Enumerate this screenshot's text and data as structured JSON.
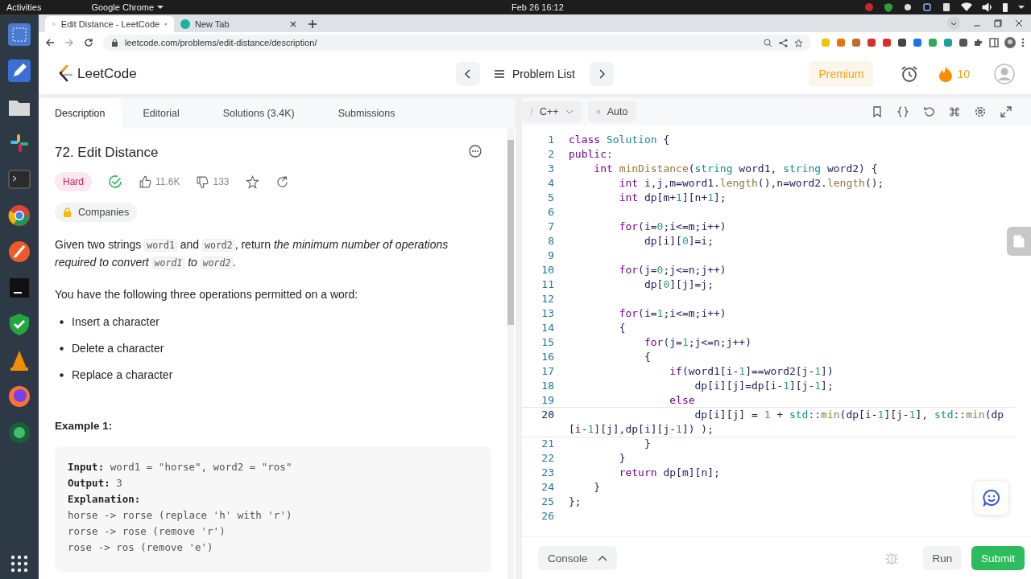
{
  "system_bar": {
    "activities": "Activities",
    "app_menu": "Google Chrome",
    "clock": "Feb 26  16:12"
  },
  "browser": {
    "tabs": [
      {
        "title": "Edit Distance - LeetCode",
        "selected": true
      },
      {
        "title": "New Tab",
        "selected": false
      }
    ],
    "url": "leetcode.com/problems/edit-distance/description/"
  },
  "header": {
    "logo": "LeetCode",
    "problem_list": "Problem List",
    "premium": "Premium",
    "streak": "10"
  },
  "tabs": [
    {
      "label": "Description",
      "selected": true
    },
    {
      "label": "Editorial",
      "selected": false
    },
    {
      "label": "Solutions (3.4K)",
      "selected": false
    },
    {
      "label": "Submissions",
      "selected": false
    }
  ],
  "problem": {
    "title": "72. Edit Distance",
    "difficulty": "Hard",
    "solved": true,
    "likes": "11.6K",
    "dislikes": "133",
    "companies": "Companies",
    "statement": [
      {
        "text": "Given two strings ",
        "kind": "text"
      },
      {
        "text": "word1",
        "kind": "code"
      },
      {
        "text": " and ",
        "kind": "text"
      },
      {
        "text": "word2",
        "kind": "code"
      },
      {
        "text": ", return ",
        "kind": "text"
      },
      {
        "text": "the minimum number of operations required to convert ",
        "kind": "em"
      },
      {
        "text": "word1",
        "kind": "em_code"
      },
      {
        "text": " to ",
        "kind": "em"
      },
      {
        "text": "word2",
        "kind": "em_code"
      },
      {
        "text": ".",
        "kind": "text"
      }
    ],
    "intro": "You have the following three operations permitted on a word:",
    "operations": [
      "Insert a character",
      "Delete a character",
      "Replace a character"
    ],
    "example": {
      "title": "Example 1:",
      "lines": [
        {
          "label": "Input:",
          "text": "word1 = \"horse\", word2 = \"ros\""
        },
        {
          "label": "Output:",
          "text": "3"
        },
        {
          "label": "Explanation:"
        },
        {
          "text": "horse -> rorse (replace 'h' with 'r')"
        },
        {
          "text": "rorse -> rose (remove 'r')"
        },
        {
          "text": "rose -> ros (remove 'e')"
        }
      ]
    }
  },
  "editor": {
    "language": "C++",
    "mode": "Auto",
    "lines": [
      {
        "number": "1",
        "active": false,
        "tokens": [
          {
            "text": "class ",
            "kind": "kw"
          },
          {
            "text": "Solution",
            "kind": "type"
          },
          {
            "text": " {",
            "kind": "plain"
          }
        ]
      },
      {
        "number": "2",
        "active": false,
        "tokens": [
          {
            "text": "public:",
            "kind": "kw"
          }
        ]
      },
      {
        "number": "3",
        "active": false,
        "tokens": [
          {
            "text": "    int ",
            "kind": "kw"
          },
          {
            "text": "minDistance",
            "kind": "fn"
          },
          {
            "text": "(",
            "kind": "plain"
          },
          {
            "text": "string",
            "kind": "type"
          },
          {
            "text": " word1, ",
            "kind": "plain"
          },
          {
            "text": "string",
            "kind": "type"
          },
          {
            "text": " word2) {",
            "kind": "plain"
          }
        ]
      },
      {
        "number": "4",
        "active": false,
        "tokens": [
          {
            "text": "        int",
            "kind": "kw"
          },
          {
            "text": " i,j,m=word1.",
            "kind": "plain"
          },
          {
            "text": "length",
            "kind": "fn"
          },
          {
            "text": "(),n=word2.",
            "kind": "plain"
          },
          {
            "text": "length",
            "kind": "fn"
          },
          {
            "text": "();",
            "kind": "plain"
          }
        ]
      },
      {
        "number": "5",
        "active": false,
        "tokens": [
          {
            "text": "        int",
            "kind": "kw"
          },
          {
            "text": " dp[m+",
            "kind": "plain"
          },
          {
            "text": "1",
            "kind": "num"
          },
          {
            "text": "][n+",
            "kind": "plain"
          },
          {
            "text": "1",
            "kind": "num"
          },
          {
            "text": "];",
            "kind": "plain"
          }
        ]
      },
      {
        "number": "6",
        "active": false
      },
      {
        "number": "7",
        "active": false,
        "tokens": [
          {
            "text": "        for",
            "kind": "kw"
          },
          {
            "text": "(i=",
            "kind": "plain"
          },
          {
            "text": "0",
            "kind": "num"
          },
          {
            "text": ";i<=m;i++)",
            "kind": "plain"
          }
        ]
      },
      {
        "number": "8",
        "active": false,
        "tokens": [
          {
            "text": "            dp[i][",
            "kind": "plain"
          },
          {
            "text": "0",
            "kind": "num"
          },
          {
            "text": "]=i;",
            "kind": "plain"
          }
        ]
      },
      {
        "number": "9",
        "active": false
      },
      {
        "number": "10",
        "active": false,
        "tokens": [
          {
            "text": "        for",
            "kind": "kw"
          },
          {
            "text": "(j=",
            "kind": "plain"
          },
          {
            "text": "0",
            "kind": "num"
          },
          {
            "text": ";j<=n;j++)",
            "kind": "plain"
          }
        ]
      },
      {
        "number": "11",
        "active": false,
        "tokens": [
          {
            "text": "            dp[",
            "kind": "plain"
          },
          {
            "text": "0",
            "kind": "num"
          },
          {
            "text": "][j]=j;",
            "kind": "plain"
          }
        ]
      },
      {
        "number": "12",
        "active": false
      },
      {
        "number": "13",
        "active": false,
        "tokens": [
          {
            "text": "        for",
            "kind": "kw"
          },
          {
            "text": "(i=",
            "kind": "plain"
          },
          {
            "text": "1",
            "kind": "num"
          },
          {
            "text": ";i<=m;i++)",
            "kind": "plain"
          }
        ]
      },
      {
        "number": "14",
        "active": false,
        "tokens": [
          {
            "text": "        {",
            "kind": "plain"
          }
        ]
      },
      {
        "number": "15",
        "active": false,
        "tokens": [
          {
            "text": "            for",
            "kind": "kw"
          },
          {
            "text": "(j=",
            "kind": "plain"
          },
          {
            "text": "1",
            "kind": "num"
          },
          {
            "text": ";j<=n;j++)",
            "kind": "plain"
          }
        ]
      },
      {
        "number": "16",
        "active": false,
        "tokens": [
          {
            "text": "            {",
            "kind": "plain"
          }
        ]
      },
      {
        "number": "17",
        "active": false,
        "tokens": [
          {
            "text": "                if",
            "kind": "kw"
          },
          {
            "text": "(word1[i-",
            "kind": "plain"
          },
          {
            "text": "1",
            "kind": "num"
          },
          {
            "text": "]==word2[j-",
            "kind": "plain"
          },
          {
            "text": "1",
            "kind": "num"
          },
          {
            "text": "])",
            "kind": "plain"
          }
        ]
      },
      {
        "number": "18",
        "active": false,
        "tokens": [
          {
            "text": "                    dp[i][j]=dp[i-",
            "kind": "plain"
          },
          {
            "text": "1",
            "kind": "num"
          },
          {
            "text": "][j-",
            "kind": "plain"
          },
          {
            "text": "1",
            "kind": "num"
          },
          {
            "text": "];",
            "kind": "plain"
          }
        ]
      },
      {
        "number": "19",
        "active": false,
        "tokens": [
          {
            "text": "                else",
            "kind": "kw"
          }
        ]
      },
      {
        "number": "20",
        "active": true,
        "tokens": [
          {
            "text": "                    dp[i][j] = ",
            "kind": "plain"
          },
          {
            "text": "1",
            "kind": "num"
          },
          {
            "text": " + ",
            "kind": "plain"
          },
          {
            "text": "std",
            "kind": "type"
          },
          {
            "text": "::",
            "kind": "plain"
          },
          {
            "text": "min",
            "kind": "fn"
          },
          {
            "text": "(dp[i-",
            "kind": "plain"
          },
          {
            "text": "1",
            "kind": "num"
          },
          {
            "text": "][j-",
            "kind": "plain"
          },
          {
            "text": "1",
            "kind": "num"
          },
          {
            "text": "], ",
            "kind": "plain"
          },
          {
            "text": "std",
            "kind": "type"
          },
          {
            "text": "::",
            "kind": "plain"
          },
          {
            "text": "min",
            "kind": "fn"
          },
          {
            "text": "(dp[i-",
            "kind": "plain"
          },
          {
            "text": "1",
            "kind": "num"
          },
          {
            "text": "][j],dp[i][j-",
            "kind": "plain"
          },
          {
            "text": "1",
            "kind": "num"
          },
          {
            "text": "]) );",
            "kind": "plain"
          }
        ]
      },
      {
        "number": "21",
        "active": false,
        "tokens": [
          {
            "text": "            }",
            "kind": "plain"
          }
        ]
      },
      {
        "number": "22",
        "active": false,
        "tokens": [
          {
            "text": "        }",
            "kind": "plain"
          }
        ]
      },
      {
        "number": "23",
        "active": false,
        "tokens": [
          {
            "text": "        return",
            "kind": "kw"
          },
          {
            "text": " dp[m][n];",
            "kind": "plain"
          }
        ]
      },
      {
        "number": "24",
        "active": false,
        "tokens": [
          {
            "text": "    }",
            "kind": "plain"
          }
        ]
      },
      {
        "number": "25",
        "active": false,
        "tokens": [
          {
            "text": "};",
            "kind": "plain"
          }
        ]
      },
      {
        "number": "26",
        "active": false
      }
    ]
  },
  "console": "Console",
  "run": "Run",
  "submit": "Submit"
}
